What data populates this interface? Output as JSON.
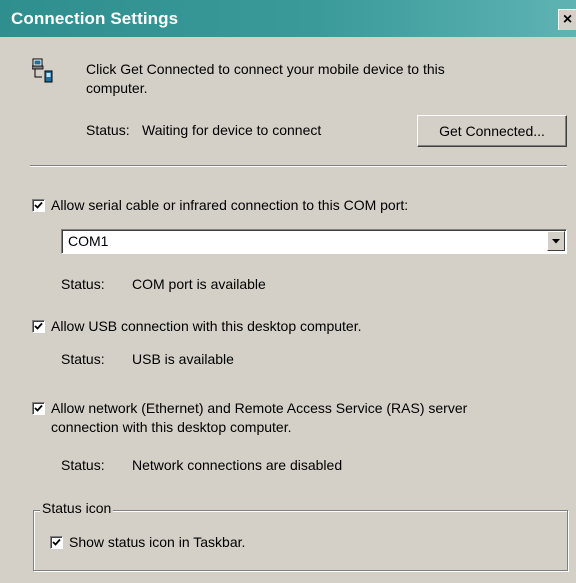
{
  "window": {
    "title": "Connection Settings",
    "close_symbol": "×"
  },
  "header": {
    "icon": "computer-device-connection-icon",
    "description_line1": "Click Get Connected to connect your mobile device to this",
    "description_line2": "computer.",
    "status_label": "Status:",
    "status_value": "Waiting for device to connect",
    "get_connected_label": "Get Connected..."
  },
  "serial": {
    "checked": true,
    "label": "Allow serial cable or infrared connection to this COM port:",
    "port_value": "COM1",
    "status_label": "Status:",
    "status_value": "COM port is available"
  },
  "usb": {
    "checked": true,
    "label": "Allow USB connection with this desktop computer.",
    "status_label": "Status:",
    "status_value": "USB is available"
  },
  "network": {
    "checked": true,
    "label_line1": "Allow network (Ethernet) and Remote Access Service (RAS) server",
    "label_line2": "connection with this desktop computer.",
    "status_label": "Status:",
    "status_value": "Network connections are disabled"
  },
  "status_icon_group": {
    "legend": "Status icon",
    "checked": true,
    "label": "Show status icon in Taskbar."
  },
  "colors": {
    "title_bar": "#2f8f8f",
    "dialog_face": "#d4d0c8"
  }
}
